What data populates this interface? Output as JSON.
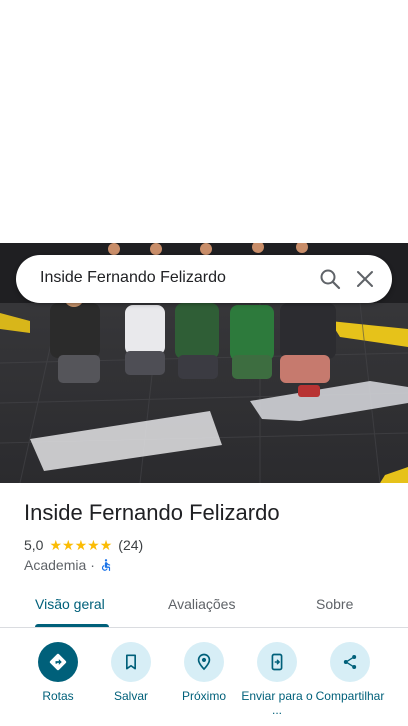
{
  "search": {
    "query": "Inside Fernando Felizardo"
  },
  "place": {
    "name": "Inside Fernando Felizardo",
    "rating": "5,0",
    "stars": 5,
    "reviews": "(24)",
    "category": "Academia",
    "separator": "·",
    "accessibility_icon": "wheelchair-icon"
  },
  "tabs": [
    {
      "label": "Visão geral",
      "active": true
    },
    {
      "label": "Avaliações",
      "active": false
    },
    {
      "label": "Sobre",
      "active": false
    }
  ],
  "actions": [
    {
      "label": "Rotas",
      "icon": "directions-icon"
    },
    {
      "label": "Salvar",
      "icon": "bookmark-icon"
    },
    {
      "label": "Próximo",
      "icon": "nearby-icon"
    },
    {
      "label": "Enviar para o ...",
      "icon": "send-to-phone-icon"
    },
    {
      "label": "Compartilhar",
      "icon": "share-icon"
    }
  ],
  "colors": {
    "accent": "#00607a",
    "action_bg": "#d7eef6",
    "star": "#fbbc04",
    "accessibility": "#1a73e8"
  }
}
